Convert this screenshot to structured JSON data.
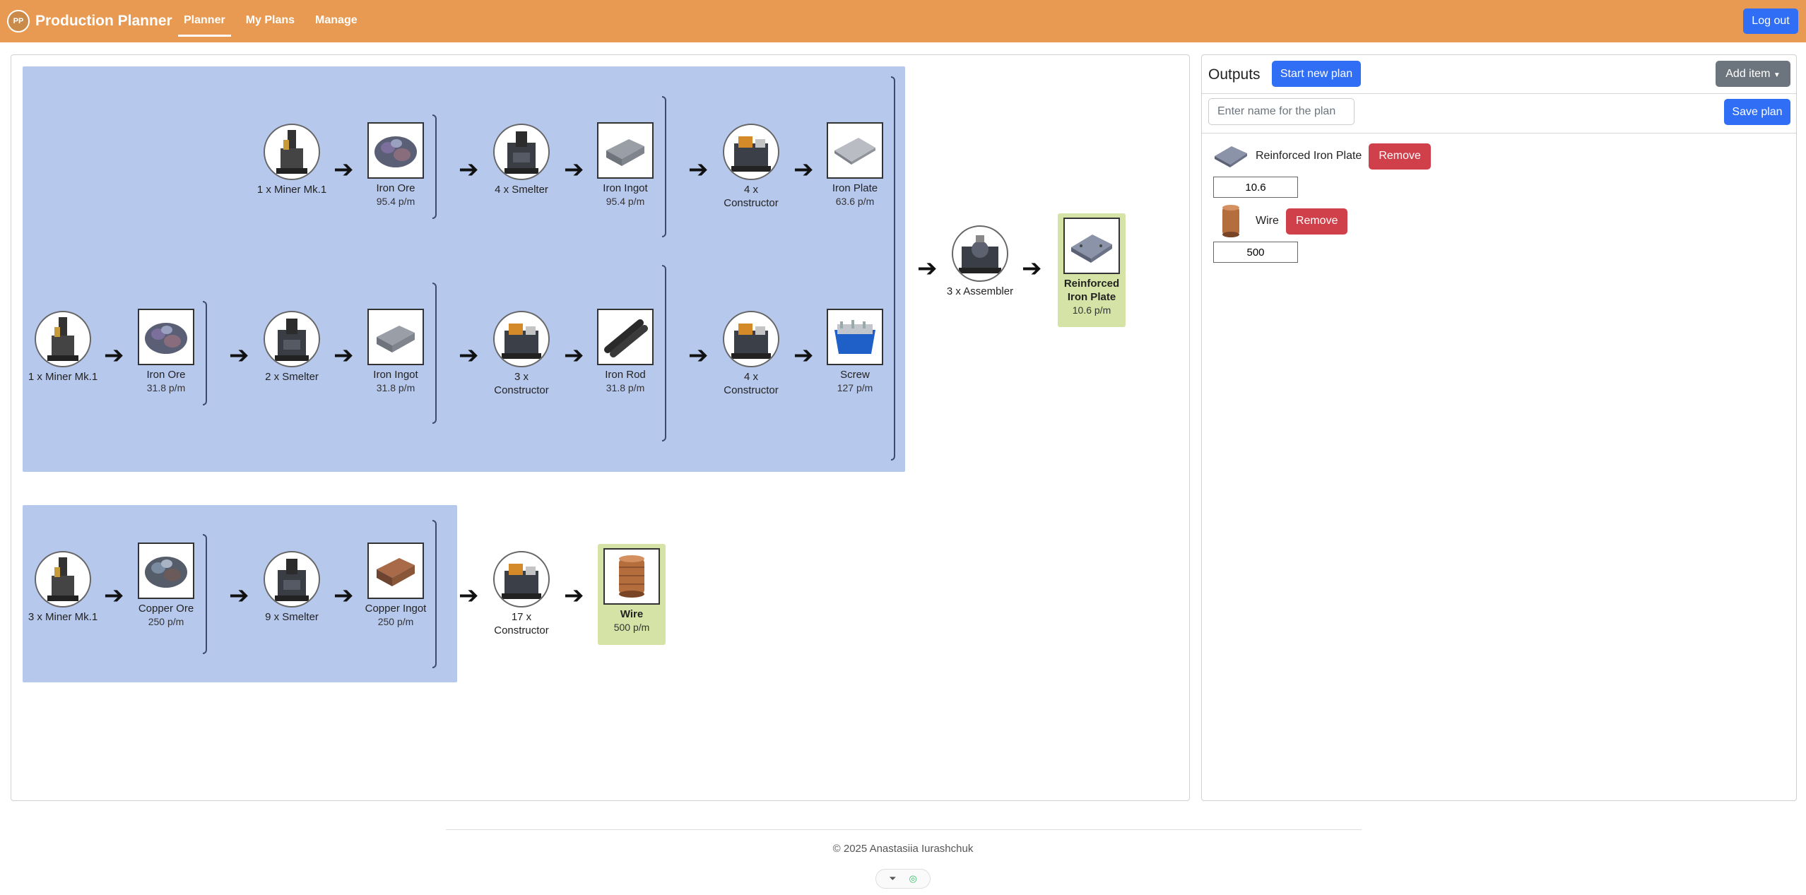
{
  "app": {
    "title": "Production Planner",
    "logo_text": "PP"
  },
  "nav": {
    "items": [
      {
        "label": "Planner"
      },
      {
        "label": "My Plans"
      },
      {
        "label": "Manage"
      }
    ],
    "logout": "Log out"
  },
  "colors": {
    "navbar": "#e99a52",
    "primary": "#2f6ef5",
    "danger": "#d0404b",
    "group_bg": "#b7c8ed",
    "final_bg": "#d6e3a6"
  },
  "planner": {
    "row1": {
      "miner": {
        "label": "1 x Miner Mk.1",
        "icon": "miner-icon"
      },
      "ore": {
        "label": "Iron Ore",
        "rate": "95.4 p/m",
        "icon": "iron-ore-icon"
      },
      "smelter": {
        "label": "4 x Smelter",
        "icon": "smelter-icon"
      },
      "ingot": {
        "label": "Iron Ingot",
        "rate": "95.4 p/m",
        "icon": "iron-ingot-icon"
      },
      "constructor": {
        "label": "4 x Constructor",
        "icon": "constructor-icon"
      },
      "plate": {
        "label": "Iron Plate",
        "rate": "63.6 p/m",
        "icon": "iron-plate-icon"
      }
    },
    "row2": {
      "miner": {
        "label": "1 x Miner Mk.1",
        "icon": "miner-icon"
      },
      "ore": {
        "label": "Iron Ore",
        "rate": "31.8 p/m",
        "icon": "iron-ore-icon"
      },
      "smelter": {
        "label": "2 x Smelter",
        "icon": "smelter-icon"
      },
      "ingot": {
        "label": "Iron Ingot",
        "rate": "31.8 p/m",
        "icon": "iron-ingot-icon"
      },
      "constructor1": {
        "label": "3 x Constructor",
        "icon": "constructor-icon"
      },
      "rod": {
        "label": "Iron Rod",
        "rate": "31.8 p/m",
        "icon": "iron-rod-icon"
      },
      "constructor2": {
        "label": "4 x Constructor",
        "icon": "constructor-icon"
      },
      "screw": {
        "label": "Screw",
        "rate": "127 p/m",
        "icon": "screw-icon"
      }
    },
    "assembler": {
      "label": "3 x Assembler",
      "icon": "assembler-icon"
    },
    "rip": {
      "label": "Reinforced Iron Plate",
      "rate": "10.6 p/m",
      "icon": "reinforced-iron-plate-icon"
    },
    "row3": {
      "miner": {
        "label": "3 x Miner Mk.1",
        "icon": "miner-icon"
      },
      "ore": {
        "label": "Copper Ore",
        "rate": "250 p/m",
        "icon": "copper-ore-icon"
      },
      "smelter": {
        "label": "9 x Smelter",
        "icon": "smelter-icon"
      },
      "ingot": {
        "label": "Copper Ingot",
        "rate": "250 p/m",
        "icon": "copper-ingot-icon"
      },
      "constructor": {
        "label": "17 x Constructor",
        "icon": "constructor-icon"
      },
      "wire": {
        "label": "Wire",
        "rate": "500 p/m",
        "icon": "wire-icon"
      }
    }
  },
  "outputs": {
    "title": "Outputs",
    "start_new": "Start new plan",
    "add_item": "Add item",
    "name_placeholder": "Enter name for the plan",
    "save": "Save plan",
    "items": [
      {
        "name": "Reinforced Iron Plate",
        "remove": "Remove",
        "quantity": "10.6"
      },
      {
        "name": "Wire",
        "remove": "Remove",
        "quantity": "500"
      }
    ]
  },
  "footer": {
    "copyright": "© 2025 Anastasiia Iurashchuk"
  }
}
